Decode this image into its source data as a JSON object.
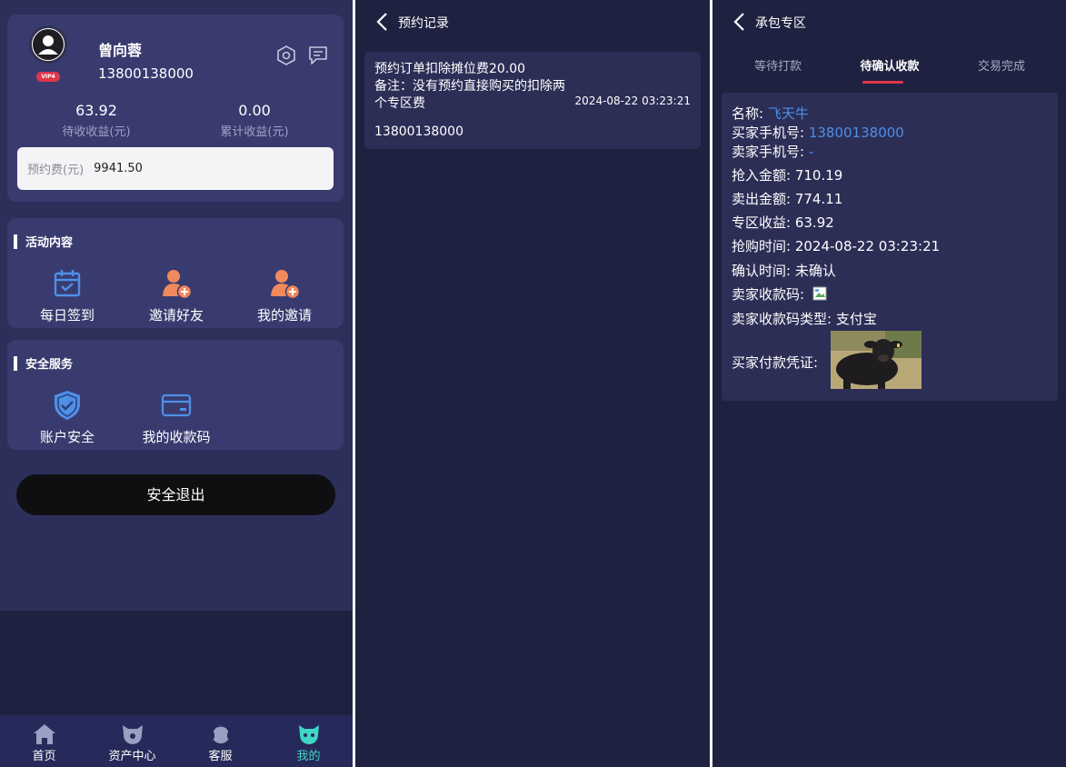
{
  "profile": {
    "name": "曾向蓉",
    "phone": "13800138000",
    "vip_badge": "VIP4",
    "pending_income_value": "63.92",
    "pending_income_label": "待收收益(元)",
    "total_income_value": "0.00",
    "total_income_label": "累计收益(元)",
    "fee_label": "预约费(元)",
    "fee_value": "9941.50"
  },
  "activity": {
    "title": "活动内容",
    "items": [
      {
        "label": "每日签到",
        "icon": "calendar-check-icon"
      },
      {
        "label": "邀请好友",
        "icon": "add-user-icon"
      },
      {
        "label": "我的邀请",
        "icon": "add-user-icon"
      }
    ]
  },
  "security": {
    "title": "安全服务",
    "items": [
      {
        "label": "账户安全",
        "icon": "shield-check-icon"
      },
      {
        "label": "我的收款码",
        "icon": "card-icon"
      }
    ]
  },
  "logout_label": "安全退出",
  "tabbar": [
    {
      "label": "首页",
      "icon": "home-icon"
    },
    {
      "label": "资产中心",
      "icon": "asset-icon"
    },
    {
      "label": "客服",
      "icon": "support-icon"
    },
    {
      "label": "我的",
      "icon": "mine-icon",
      "active": true
    }
  ],
  "records": {
    "title": "预约记录",
    "item": {
      "line1": "预约订单扣除摊位费20.00",
      "line2": "备注：没有预约直接购买的扣除两",
      "line3": "个专区费",
      "time": "2024-08-22 03:23:21",
      "phone": "13800138000"
    }
  },
  "contract": {
    "title": "承包专区",
    "tabs": [
      "等待打款",
      "待确认收款",
      "交易完成"
    ],
    "active_tab": 1,
    "detail": {
      "name_label": "名称:",
      "name_value": "飞天牛",
      "buyer_phone_label": "买家手机号:",
      "buyer_phone_value": "13800138000",
      "seller_phone_label": "卖家手机号:",
      "seller_phone_value": "-",
      "buy_amount_label": "抢入金额:",
      "buy_amount_value": "710.19",
      "sell_amount_label": "卖出金额:",
      "sell_amount_value": "774.11",
      "zone_income_label": "专区收益:",
      "zone_income_value": "63.92",
      "grab_time_label": "抢购时间:",
      "grab_time_value": "2024-08-22 03:23:21",
      "confirm_time_label": "确认时间:",
      "confirm_time_value": "未确认",
      "seller_qr_label": "卖家收款码:",
      "seller_qr_type_label": "卖家收款码类型:",
      "seller_qr_type_value": "支付宝",
      "buyer_proof_label": "买家付款凭证:"
    }
  },
  "colors": {
    "bg_dark": "#1f2140",
    "card": "#393b6f",
    "accent_red": "#e0354a",
    "link_blue": "#4d8fe6",
    "active_teal": "#3fd6c4",
    "icon_blue": "#4f8fe8",
    "icon_orange": "#f08a5d"
  }
}
